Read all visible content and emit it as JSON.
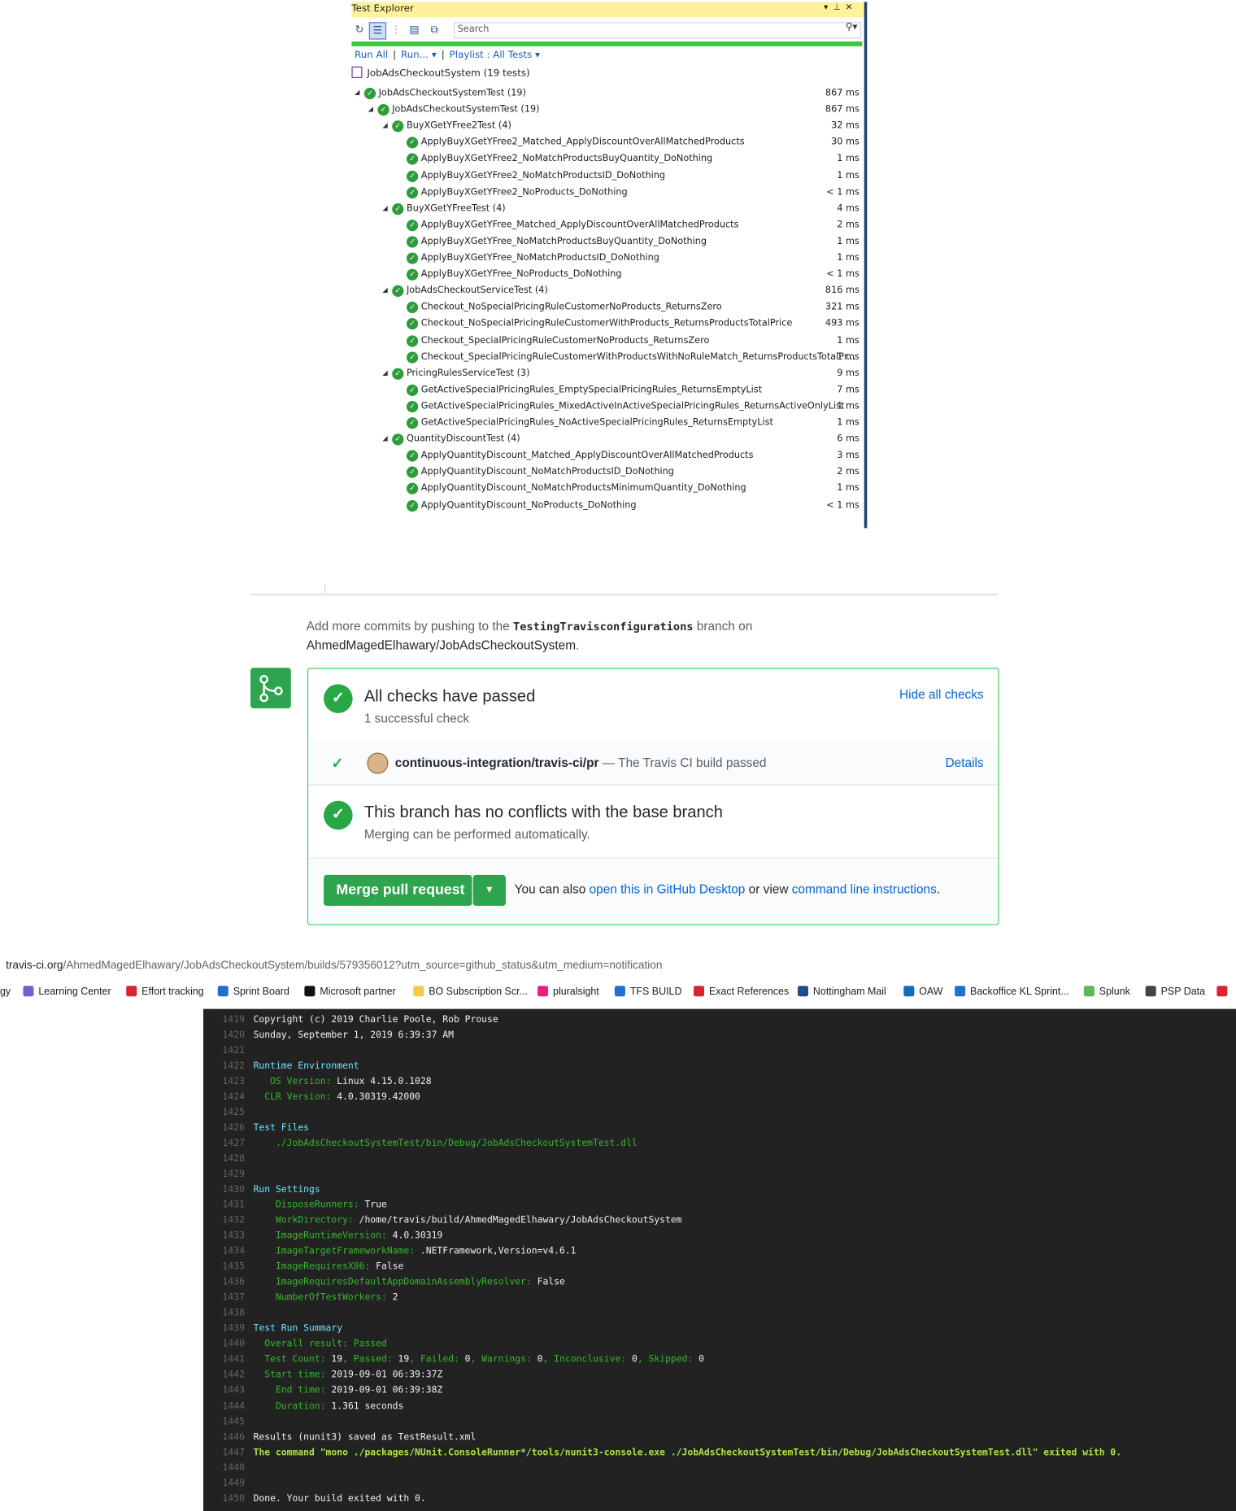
{
  "test_explorer": {
    "title": "Test Explorer",
    "search_placeholder": "Search",
    "actions": {
      "run_all": "Run All",
      "run": "Run...",
      "playlist": "Playlist : All Tests"
    },
    "root": "JobAdsCheckoutSystem (19 tests)",
    "rows": [
      {
        "name": "JobAdsCheckoutSystemTest (19)",
        "time": "867 ms",
        "level": 0,
        "group": true
      },
      {
        "name": "JobAdsCheckoutSystemTest (19)",
        "time": "867 ms",
        "level": 1,
        "group": true
      },
      {
        "name": "BuyXGetYFree2Test (4)",
        "time": "32 ms",
        "level": 2,
        "group": true
      },
      {
        "name": "ApplyBuyXGetYFree2_Matched_ApplyDiscountOverAllMatchedProducts",
        "time": "30 ms",
        "level": 3,
        "group": false
      },
      {
        "name": "ApplyBuyXGetYFree2_NoMatchProductsBuyQuantity_DoNothing",
        "time": "1 ms",
        "level": 3,
        "group": false
      },
      {
        "name": "ApplyBuyXGetYFree2_NoMatchProductsID_DoNothing",
        "time": "1 ms",
        "level": 3,
        "group": false
      },
      {
        "name": "ApplyBuyXGetYFree2_NoProducts_DoNothing",
        "time": "< 1 ms",
        "level": 3,
        "group": false
      },
      {
        "name": "BuyXGetYFreeTest (4)",
        "time": "4 ms",
        "level": 2,
        "group": true
      },
      {
        "name": "ApplyBuyXGetYFree_Matched_ApplyDiscountOverAllMatchedProducts",
        "time": "2 ms",
        "level": 3,
        "group": false
      },
      {
        "name": "ApplyBuyXGetYFree_NoMatchProductsBuyQuantity_DoNothing",
        "time": "1 ms",
        "level": 3,
        "group": false
      },
      {
        "name": "ApplyBuyXGetYFree_NoMatchProductsID_DoNothing",
        "time": "1 ms",
        "level": 3,
        "group": false
      },
      {
        "name": "ApplyBuyXGetYFree_NoProducts_DoNothing",
        "time": "< 1 ms",
        "level": 3,
        "group": false
      },
      {
        "name": "JobAdsCheckoutServiceTest (4)",
        "time": "816 ms",
        "level": 2,
        "group": true
      },
      {
        "name": "Checkout_NoSpecialPricingRuleCustomerNoProducts_ReturnsZero",
        "time": "321 ms",
        "level": 3,
        "group": false
      },
      {
        "name": "Checkout_NoSpecialPricingRuleCustomerWithProducts_ReturnsProductsTotalPrice",
        "time": "493 ms",
        "level": 3,
        "group": false
      },
      {
        "name": "Checkout_SpecialPricingRuleCustomerNoProducts_ReturnsZero",
        "time": "1 ms",
        "level": 3,
        "group": false
      },
      {
        "name": "Checkout_SpecialPricingRuleCustomerWithProductsWithNoRuleMatch_ReturnsProductsTotalPr...",
        "time": "1 ms",
        "level": 3,
        "group": false
      },
      {
        "name": "PricingRulesServiceTest (3)",
        "time": "9 ms",
        "level": 2,
        "group": true
      },
      {
        "name": "GetActiveSpecialPricingRules_EmptySpecialPricingRules_ReturnsEmptyList",
        "time": "7 ms",
        "level": 3,
        "group": false
      },
      {
        "name": "GetActiveSpecialPricingRules_MixedActiveInActiveSpecialPricingRules_ReturnsActiveOnlyList",
        "time": "1 ms",
        "level": 3,
        "group": false
      },
      {
        "name": "GetActiveSpecialPricingRules_NoActiveSpecialPricingRules_ReturnsEmptyList",
        "time": "1 ms",
        "level": 3,
        "group": false
      },
      {
        "name": "QuantityDiscountTest (4)",
        "time": "6 ms",
        "level": 2,
        "group": true
      },
      {
        "name": "ApplyQuantityDiscount_Matched_ApplyDiscountOverAllMatchedProducts",
        "time": "3 ms",
        "level": 3,
        "group": false
      },
      {
        "name": "ApplyQuantityDiscount_NoMatchProductsID_DoNothing",
        "time": "2 ms",
        "level": 3,
        "group": false
      },
      {
        "name": "ApplyQuantityDiscount_NoMatchProductsMinimumQuantity_DoNothing",
        "time": "1 ms",
        "level": 3,
        "group": false
      },
      {
        "name": "ApplyQuantityDiscount_NoProducts_DoNothing",
        "time": "< 1 ms",
        "level": 3,
        "group": false
      }
    ]
  },
  "github": {
    "hint_prefix": "Add more commits by pushing to the ",
    "hint_branch": "TestingTravisconfigurations",
    "hint_mid": " branch on",
    "hint_repo": "AhmedMagedElhawary/JobAdsCheckoutSystem",
    "hint_end": ".",
    "checks_title": "All checks have passed",
    "checks_sub": "1 successful check",
    "hide_checks": "Hide all checks",
    "check_name": "continuous-integration/travis-ci/pr",
    "check_desc": " — The Travis CI build passed",
    "details": "Details",
    "conflict_title": "This branch has no conflicts with the base branch",
    "conflict_sub": "Merging can be performed automatically.",
    "merge_button": "Merge pull request",
    "alt_prefix": "You can also ",
    "alt_link1": "open this in GitHub Desktop",
    "alt_mid": " or view ",
    "alt_link2": "command line instructions",
    "alt_end": "."
  },
  "browser": {
    "url_host": "travis-ci.org",
    "url_path": "/AhmedMagedElhawary/JobAdsCheckoutSystem/builds/579356012?utm_source=github_status&utm_medium=notification",
    "bookmarks": [
      {
        "label": "gy",
        "color": "#ffffff"
      },
      {
        "label": "Learning Center",
        "color": "#7b5cd6"
      },
      {
        "label": "Effort tracking",
        "color": "#d9232e"
      },
      {
        "label": "Sprint Board",
        "color": "#1f6fd0"
      },
      {
        "label": "Microsoft partner",
        "color": "#111111"
      },
      {
        "label": "BO Subscription Scr...",
        "color": "#f2c94c"
      },
      {
        "label": "pluralsight",
        "color": "#e5217a"
      },
      {
        "label": "TFS BUILD",
        "color": "#1f6fd0"
      },
      {
        "label": "Exact References",
        "color": "#d9232e"
      },
      {
        "label": "Nottingham Mail",
        "color": "#1f4e8c"
      },
      {
        "label": "OAW",
        "color": "#0f6cbd"
      },
      {
        "label": "Backoffice KL Sprint...",
        "color": "#1f6fd0"
      },
      {
        "label": "Splunk",
        "color": "#5cb85c"
      },
      {
        "label": "PSP Data",
        "color": "#444444"
      },
      {
        "label": "",
        "color": "#d9232e"
      }
    ]
  },
  "log": {
    "lines": [
      {
        "no": "1419",
        "segs": [
          {
            "t": "Copyright (c) 2019 Charlie Poole, Rob Prouse",
            "c": "white"
          }
        ]
      },
      {
        "no": "1420",
        "segs": [
          {
            "t": "Sunday, September 1, 2019 6:39:37 AM",
            "c": "white"
          }
        ]
      },
      {
        "no": "1421",
        "segs": []
      },
      {
        "no": "1422",
        "segs": [
          {
            "t": "Runtime Environment",
            "c": "cyan"
          }
        ]
      },
      {
        "no": "1423",
        "segs": [
          {
            "t": "   OS Version: ",
            "c": "green"
          },
          {
            "t": "Linux 4.15.0.1028",
            "c": "white"
          }
        ]
      },
      {
        "no": "1424",
        "segs": [
          {
            "t": "  CLR Version: ",
            "c": "green"
          },
          {
            "t": "4.0.30319.42000",
            "c": "white"
          }
        ]
      },
      {
        "no": "1425",
        "segs": []
      },
      {
        "no": "1426",
        "segs": [
          {
            "t": "Test Files",
            "c": "cyan"
          }
        ]
      },
      {
        "no": "1427",
        "segs": [
          {
            "t": "    ./JobAdsCheckoutSystemTest/bin/Debug/JobAdsCheckoutSystemTest.dll",
            "c": "green"
          }
        ]
      },
      {
        "no": "1428",
        "segs": []
      },
      {
        "no": "1429",
        "segs": []
      },
      {
        "no": "1430",
        "segs": [
          {
            "t": "Run Settings",
            "c": "cyan"
          }
        ]
      },
      {
        "no": "1431",
        "segs": [
          {
            "t": "    DisposeRunners: ",
            "c": "green"
          },
          {
            "t": "True",
            "c": "white"
          }
        ]
      },
      {
        "no": "1432",
        "segs": [
          {
            "t": "    WorkDirectory: ",
            "c": "green"
          },
          {
            "t": "/home/travis/build/AhmedMagedElhawary/JobAdsCheckoutSystem",
            "c": "white"
          }
        ]
      },
      {
        "no": "1433",
        "segs": [
          {
            "t": "    ImageRuntimeVersion: ",
            "c": "green"
          },
          {
            "t": "4.0.30319",
            "c": "white"
          }
        ]
      },
      {
        "no": "1434",
        "segs": [
          {
            "t": "    ImageTargetFrameworkName: ",
            "c": "green"
          },
          {
            "t": ".NETFramework,Version=v4.6.1",
            "c": "white"
          }
        ]
      },
      {
        "no": "1435",
        "segs": [
          {
            "t": "    ImageRequiresX86: ",
            "c": "green"
          },
          {
            "t": "False",
            "c": "white"
          }
        ]
      },
      {
        "no": "1436",
        "segs": [
          {
            "t": "    ImageRequiresDefaultAppDomainAssemblyResolver: ",
            "c": "green"
          },
          {
            "t": "False",
            "c": "white"
          }
        ]
      },
      {
        "no": "1437",
        "segs": [
          {
            "t": "    NumberOfTestWorkers: ",
            "c": "green"
          },
          {
            "t": "2",
            "c": "white"
          }
        ]
      },
      {
        "no": "1438",
        "segs": []
      },
      {
        "no": "1439",
        "segs": [
          {
            "t": "Test Run Summary",
            "c": "cyan"
          }
        ]
      },
      {
        "no": "1440",
        "segs": [
          {
            "t": "  Overall result: Passed",
            "c": "green"
          }
        ]
      },
      {
        "no": "1441",
        "segs": [
          {
            "t": "  Test Count: ",
            "c": "green"
          },
          {
            "t": "19",
            "c": "white"
          },
          {
            "t": ", Passed: ",
            "c": "green"
          },
          {
            "t": "19",
            "c": "white"
          },
          {
            "t": ", Failed: ",
            "c": "green"
          },
          {
            "t": "0",
            "c": "white"
          },
          {
            "t": ", Warnings: ",
            "c": "green"
          },
          {
            "t": "0",
            "c": "white"
          },
          {
            "t": ", Inconclusive: ",
            "c": "green"
          },
          {
            "t": "0",
            "c": "white"
          },
          {
            "t": ", Skipped: ",
            "c": "green"
          },
          {
            "t": "0",
            "c": "white"
          }
        ]
      },
      {
        "no": "1442",
        "segs": [
          {
            "t": "  Start time: ",
            "c": "green"
          },
          {
            "t": "2019-09-01 06:39:37Z",
            "c": "white"
          }
        ]
      },
      {
        "no": "1443",
        "segs": [
          {
            "t": "    End time: ",
            "c": "green"
          },
          {
            "t": "2019-09-01 06:39:38Z",
            "c": "white"
          }
        ]
      },
      {
        "no": "1444",
        "segs": [
          {
            "t": "    Duration: ",
            "c": "green"
          },
          {
            "t": "1.361 seconds",
            "c": "white"
          }
        ]
      },
      {
        "no": "1445",
        "segs": []
      },
      {
        "no": "1446",
        "segs": [
          {
            "t": "Results (nunit3) saved as TestResult.xml",
            "c": "white"
          }
        ]
      },
      {
        "no": "1447",
        "segs": [
          {
            "t": "The command \"mono ./packages/NUnit.ConsoleRunner*/tools/nunit3-console.exe ./JobAdsCheckoutSystemTest/bin/Debug/JobAdsCheckoutSystemTest.dll\" exited with 0.",
            "c": "lime"
          }
        ]
      },
      {
        "no": "1448",
        "segs": []
      },
      {
        "no": "1449",
        "segs": []
      },
      {
        "no": "1450",
        "segs": [
          {
            "t": "Done. Your build exited with 0.",
            "c": "white"
          }
        ]
      }
    ]
  }
}
